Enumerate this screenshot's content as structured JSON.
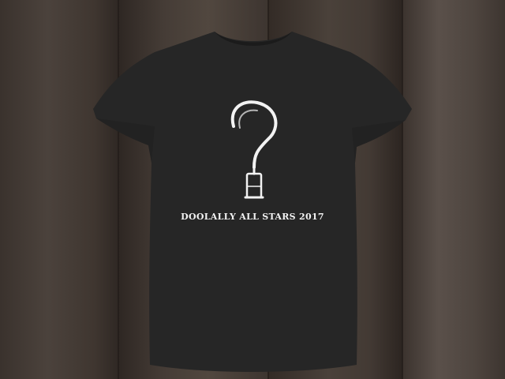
{
  "photo": {
    "subject": "tshirt",
    "background": "wooden-planks",
    "colors": {
      "shirt": "#262626",
      "shirt_shadow": "#1b1b1b",
      "print": "#f2f2f2",
      "wood_dark": "#3a322d",
      "wood_mid": "#4a413b",
      "wood_light": "#5a504a"
    },
    "print_graphic": "question-mark-beer-glass-icon",
    "print_text": "DOOLALLY ALL STARS 2017"
  }
}
